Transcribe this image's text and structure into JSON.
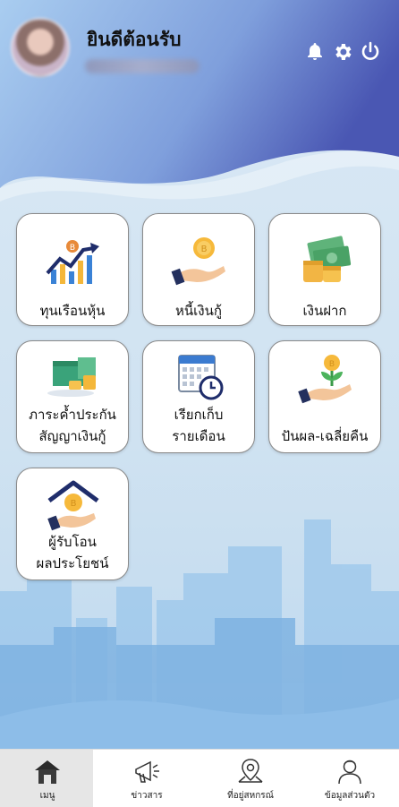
{
  "header": {
    "welcome": "ยินดีต้อนรับ",
    "icons": [
      "bell-icon",
      "gear-icon",
      "power-icon"
    ]
  },
  "menu": {
    "items": [
      {
        "label1": "ทุนเรือนหุ้น",
        "label2": "",
        "icon": "stock-chart-icon"
      },
      {
        "label1": "หนี้เงินกู้",
        "label2": "",
        "icon": "coin-hand-icon"
      },
      {
        "label1": "เงินฝาก",
        "label2": "",
        "icon": "money-stack-icon"
      },
      {
        "label1": "ภาระค้ำประกัน",
        "label2": "สัญญาเงินกู้",
        "icon": "money-box-icon"
      },
      {
        "label1": "เรียกเก็บ",
        "label2": "รายเดือน",
        "icon": "calendar-clock-icon"
      },
      {
        "label1": "ปันผล-เฉลี่ยคืน",
        "label2": "",
        "icon": "plant-coin-icon"
      },
      {
        "label1": "ผู้รับโอน",
        "label2": "ผลประโยชน์",
        "icon": "house-coin-icon"
      }
    ]
  },
  "nav": {
    "items": [
      {
        "label": "เมนู",
        "icon": "home-icon"
      },
      {
        "label": "ข่าวสาร",
        "icon": "megaphone-icon"
      },
      {
        "label": "ที่อยู่สหกรณ์",
        "icon": "map-pin-icon"
      },
      {
        "label": "ข้อมูลส่วนตัว",
        "icon": "user-icon"
      }
    ]
  },
  "colors": {
    "header_top": "#4f63b8",
    "header_bottom": "#8fb3e6",
    "city": "#8cbde8"
  }
}
